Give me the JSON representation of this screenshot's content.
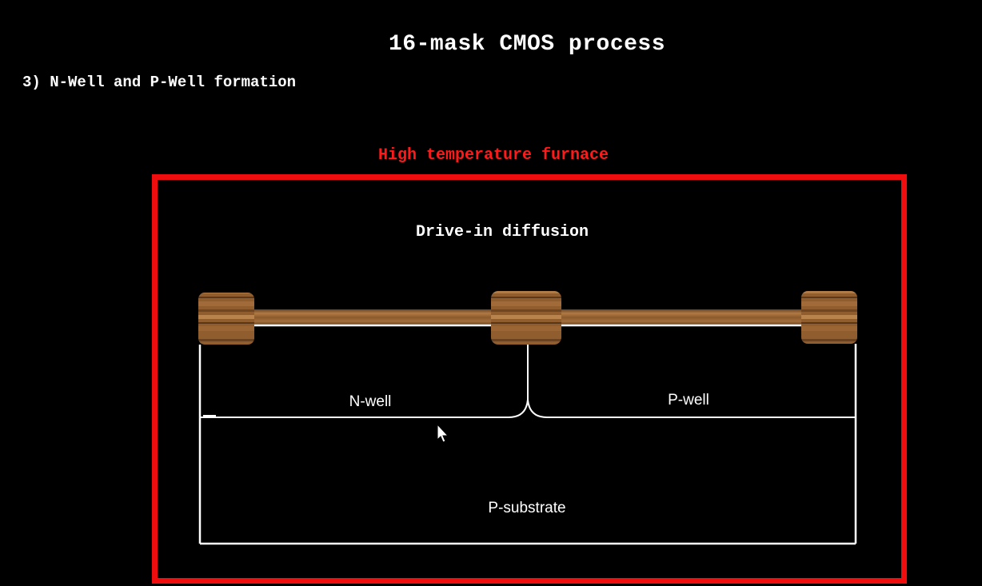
{
  "slide": {
    "title": "16-mask CMOS process",
    "step": "3) N-Well and P-Well formation"
  },
  "furnace": {
    "label": "High temperature furnace",
    "border_color": "#f00d0d",
    "label_color": "#ff1a1a"
  },
  "process_step": "Drive-in diffusion",
  "wafer": {
    "regions": {
      "n_well": "N-well",
      "p_well": "P-well",
      "substrate": "P-substrate"
    },
    "oxide_color": "#8a5a2b"
  },
  "cursor": {
    "icon": "mouse-pointer-icon"
  }
}
